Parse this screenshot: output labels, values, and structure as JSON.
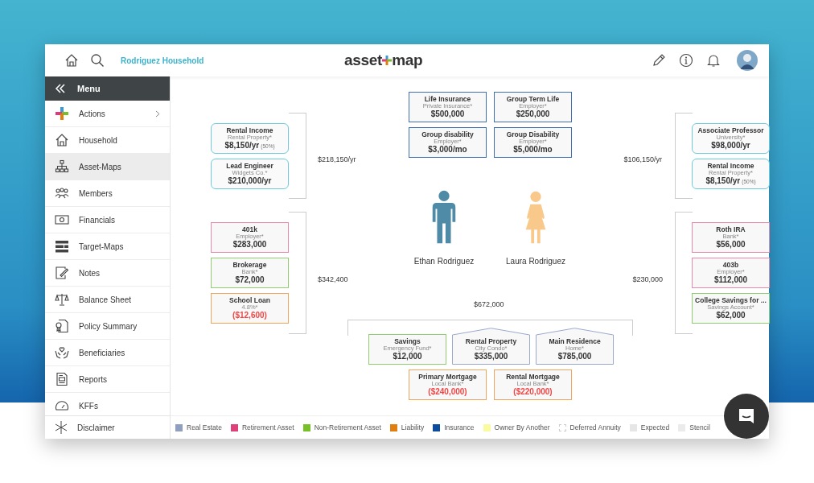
{
  "header": {
    "household": "Rodriguez Household",
    "logo": {
      "left": "asset",
      "right": "map"
    }
  },
  "sidebar": {
    "menu_label": "Menu",
    "items": [
      {
        "label": "Actions",
        "selected": false,
        "has_submenu": true
      },
      {
        "label": "Household",
        "selected": false,
        "has_submenu": false
      },
      {
        "label": "Asset-Maps",
        "selected": true,
        "has_submenu": false
      },
      {
        "label": "Members",
        "selected": false,
        "has_submenu": false
      },
      {
        "label": "Financials",
        "selected": false,
        "has_submenu": false
      },
      {
        "label": "Target-Maps",
        "selected": false,
        "has_submenu": false
      },
      {
        "label": "Notes",
        "selected": false,
        "has_submenu": false
      },
      {
        "label": "Balance Sheet",
        "selected": false,
        "has_submenu": false
      },
      {
        "label": "Policy Summary",
        "selected": false,
        "has_submenu": false
      },
      {
        "label": "Beneficiaries",
        "selected": false,
        "has_submenu": false
      },
      {
        "label": "Reports",
        "selected": false,
        "has_submenu": false
      },
      {
        "label": "KFFs",
        "selected": false,
        "has_submenu": false
      }
    ],
    "footer": "Disclaimer"
  },
  "map": {
    "left_income": {
      "total": "$218,150/yr",
      "items": [
        {
          "kind": "income",
          "title": "Rental Income",
          "subtitle": "Rental Property*",
          "value": "$8,150/yr",
          "share": "(50%)"
        },
        {
          "kind": "income",
          "title": "Lead Engineer",
          "subtitle": "Widgets Co.*",
          "value": "$210,000/yr"
        }
      ]
    },
    "left_assets": {
      "total": "$342,400",
      "items": [
        {
          "kind": "retirement",
          "title": "401k",
          "subtitle": "Employer*",
          "value": "$283,000"
        },
        {
          "kind": "non_retirement",
          "title": "Brokerage",
          "subtitle": "Bank*",
          "value": "$72,000"
        },
        {
          "kind": "liability",
          "title": "School Loan",
          "subtitle": "4.8%*",
          "value": "($12,600)"
        }
      ]
    },
    "insurance": [
      {
        "kind": "insurance",
        "title": "Life Insurance",
        "subtitle": "Private Insurance*",
        "value": "$500,000"
      },
      {
        "kind": "insurance",
        "title": "Group Term Life",
        "subtitle": "Employer*",
        "value": "$250,000"
      },
      {
        "kind": "insurance",
        "title": "Group disability",
        "subtitle": "Employer*",
        "value": "$3,000/mo"
      },
      {
        "kind": "insurance",
        "title": "Group Disability",
        "subtitle": "Employer*",
        "value": "$5,000/mo"
      }
    ],
    "members": [
      {
        "name": "Ethan Rodriguez",
        "color": "#4f8aa6"
      },
      {
        "name": "Laura Rodriguez",
        "color": "#f8c98a"
      }
    ],
    "right_income": {
      "total": "$106,150/yr",
      "items": [
        {
          "kind": "income",
          "title": "Associate Professor",
          "subtitle": "University*",
          "value": "$98,000/yr"
        },
        {
          "kind": "income",
          "title": "Rental Income",
          "subtitle": "Rental Property*",
          "value": "$8,150/yr",
          "share": "(50%)"
        }
      ]
    },
    "right_assets": {
      "total": "$230,000",
      "items": [
        {
          "kind": "retirement",
          "title": "Roth IRA",
          "subtitle": "Bank*",
          "value": "$56,000"
        },
        {
          "kind": "retirement",
          "title": "403b",
          "subtitle": "Employer*",
          "value": "$112,000"
        },
        {
          "kind": "non_retirement",
          "title": "College Savings for ...",
          "subtitle": "Savings Account*",
          "value": "$62,000"
        }
      ]
    },
    "joint": {
      "total": "$672,000",
      "assets": [
        {
          "kind": "non_retirement",
          "title": "Savings",
          "subtitle": "Emergency Fund*",
          "value": "$12,000"
        },
        {
          "kind": "real_estate",
          "title": "Rental Property",
          "subtitle": "City Condo*",
          "value": "$335,000"
        },
        {
          "kind": "real_estate",
          "title": "Main Residence",
          "subtitle": "Home*",
          "value": "$785,000"
        }
      ],
      "liabilities": [
        {
          "kind": "liability",
          "title": "Primary Mortgage",
          "subtitle": "Local Bank*",
          "value": "($240,000)"
        },
        {
          "kind": "liability",
          "title": "Rental Mortgage",
          "subtitle": "Local Bank*",
          "value": "($220,000)"
        }
      ]
    }
  },
  "legend": [
    {
      "label": "Real Estate",
      "kind": "solid",
      "color": "#8e9fc0"
    },
    {
      "label": "Retirement Asset",
      "kind": "solid",
      "color": "#e0407a"
    },
    {
      "label": "Non-Retirement Asset",
      "kind": "solid",
      "color": "#78c028"
    },
    {
      "label": "Liability",
      "kind": "solid",
      "color": "#e07e10"
    },
    {
      "label": "Insurance",
      "kind": "solid",
      "color": "#0c4c9c"
    },
    {
      "label": "Owner By Another",
      "kind": "solid",
      "color": "#fafaa0"
    },
    {
      "label": "Deferred Annuity",
      "kind": "dashed",
      "color": "#cccccc"
    },
    {
      "label": "Expected",
      "kind": "outlined",
      "color": "#e6e6e6"
    },
    {
      "label": "Stencil",
      "kind": "solid",
      "color": "#ebebeb"
    }
  ]
}
